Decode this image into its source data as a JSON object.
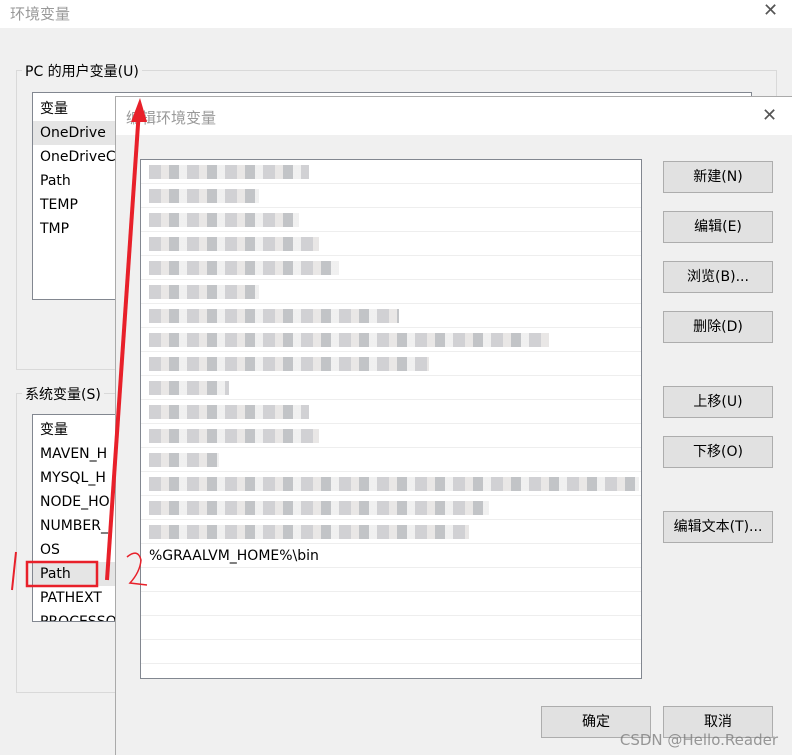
{
  "main_window": {
    "title": "环境变量",
    "user_group_label": "PC 的用户变量(U)",
    "user_vars_header": "变量",
    "user_vars": [
      "OneDrive",
      "OneDriveC",
      "Path",
      "TEMP",
      "TMP"
    ],
    "system_group_label": "系统变量(S)",
    "system_vars_header": "变量",
    "system_vars": [
      "MAVEN_H",
      "MYSQL_H",
      "NODE_HO",
      "NUMBER_",
      "OS",
      "Path",
      "PATHEXT",
      "PROCESSO"
    ]
  },
  "dialog": {
    "title": "编辑环境变量",
    "entries": [
      "%GRAALVM_HOME%\\bin"
    ],
    "buttons": {
      "new": "新建(N)",
      "edit": "编辑(E)",
      "browse": "浏览(B)...",
      "delete": "删除(D)",
      "move_up": "上移(U)",
      "move_down": "下移(O)",
      "edit_text": "编辑文本(T)...",
      "ok": "确定",
      "cancel": "取消"
    }
  },
  "annotations": {
    "step1": "1",
    "step2": "2",
    "color": "#e8202a"
  },
  "watermark": "CSDN @Hello.Reader"
}
